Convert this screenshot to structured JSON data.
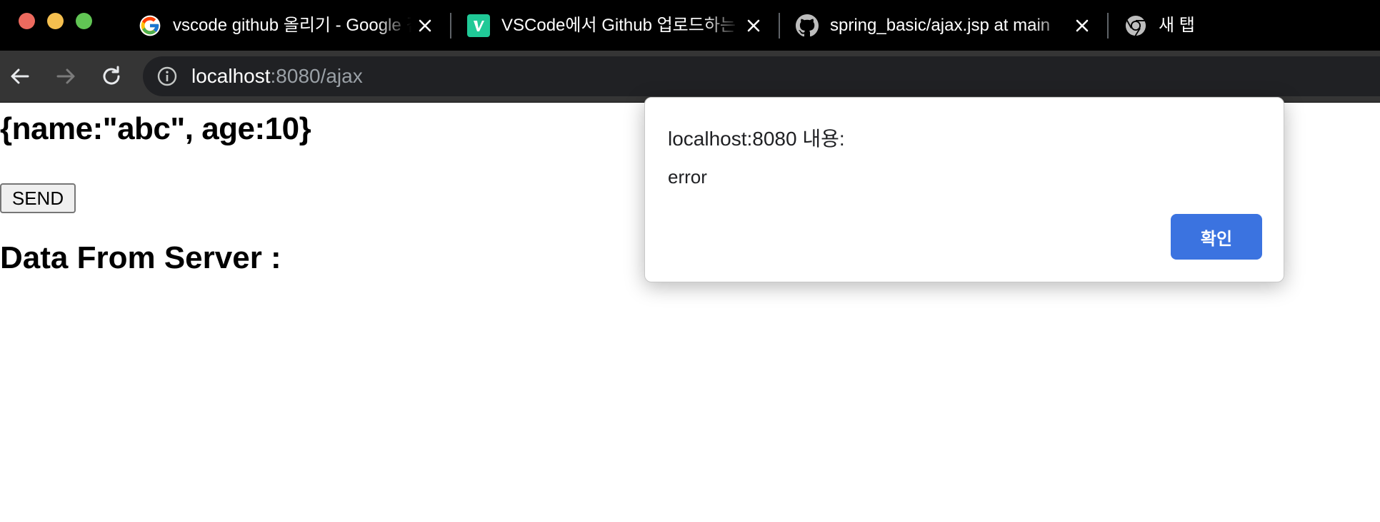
{
  "browser": {
    "tabs": [
      {
        "title": "vscode github 올리기 - Google 검색",
        "icon": "google-icon",
        "closable": true
      },
      {
        "title": "VSCode에서 Github 업로드하는 방법",
        "icon": "velog-icon",
        "closable": true
      },
      {
        "title": "spring_basic/ajax.jsp at main",
        "icon": "github-icon",
        "closable": true
      },
      {
        "title": "새 탭",
        "icon": "chrome-icon",
        "closable": false
      }
    ],
    "address": {
      "host": "localhost",
      "path": ":8080/ajax"
    }
  },
  "page": {
    "json_text": "{name:\"abc\", age:10}",
    "send_label": "SEND",
    "server_heading": "Data From Server :"
  },
  "dialog": {
    "title": "localhost:8080 내용:",
    "message": "error",
    "ok_label": "확인"
  },
  "colors": {
    "tabstrip_bg": "#000000",
    "toolbar_bg": "#353535",
    "omnibox_bg": "#202124",
    "dialog_button": "#3b73e0"
  }
}
